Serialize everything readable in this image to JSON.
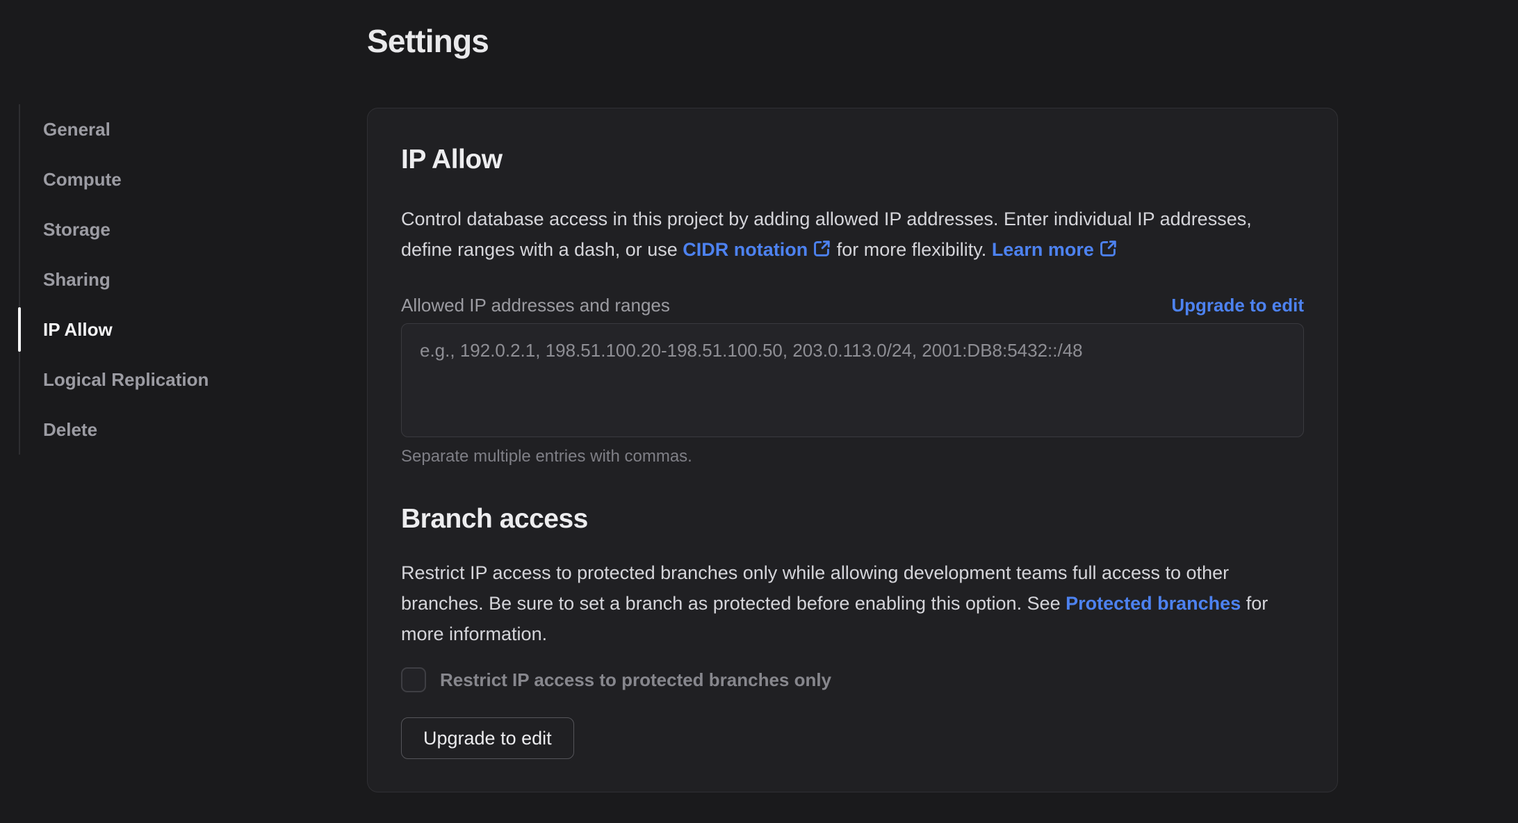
{
  "page": {
    "title": "Settings"
  },
  "colors": {
    "page_bg": "#1a1a1c",
    "card_bg": "#202023",
    "link_blue": "#4d82f0",
    "active_item": "#f5f5f6"
  },
  "sidebar": {
    "items": [
      {
        "label": "General",
        "active": false
      },
      {
        "label": "Compute",
        "active": false
      },
      {
        "label": "Storage",
        "active": false
      },
      {
        "label": "Sharing",
        "active": false
      },
      {
        "label": "IP Allow",
        "active": true
      },
      {
        "label": "Logical Replication",
        "active": false
      },
      {
        "label": "Delete",
        "active": false
      }
    ]
  },
  "ip_allow": {
    "heading": "IP Allow",
    "desc_part1": "Control database access in this project by adding allowed IP addresses. Enter individual IP addresses, define ranges with a dash, or use ",
    "cidr_link_label": "CIDR notation",
    "desc_part2": " for more flexibility. ",
    "learn_more_label": "Learn more",
    "field_label": "Allowed IP addresses and ranges",
    "upgrade_link_label": "Upgrade to edit",
    "textarea_placeholder": "e.g., 192.0.2.1, 198.51.100.20-198.51.100.50, 203.0.113.0/24, 2001:DB8:5432::/48",
    "textarea_value": "",
    "helper": "Separate multiple entries with commas."
  },
  "branch_access": {
    "heading": "Branch access",
    "desc_part1": "Restrict IP access to protected branches only while allowing development teams full access to other branches. Be sure to set a branch as protected before enabling this option. See ",
    "protected_link_label": "Protected branches",
    "desc_part2": " for more information.",
    "checkbox_label": "Restrict IP access to protected branches only",
    "checkbox_checked": false,
    "button_label": "Upgrade to edit"
  }
}
